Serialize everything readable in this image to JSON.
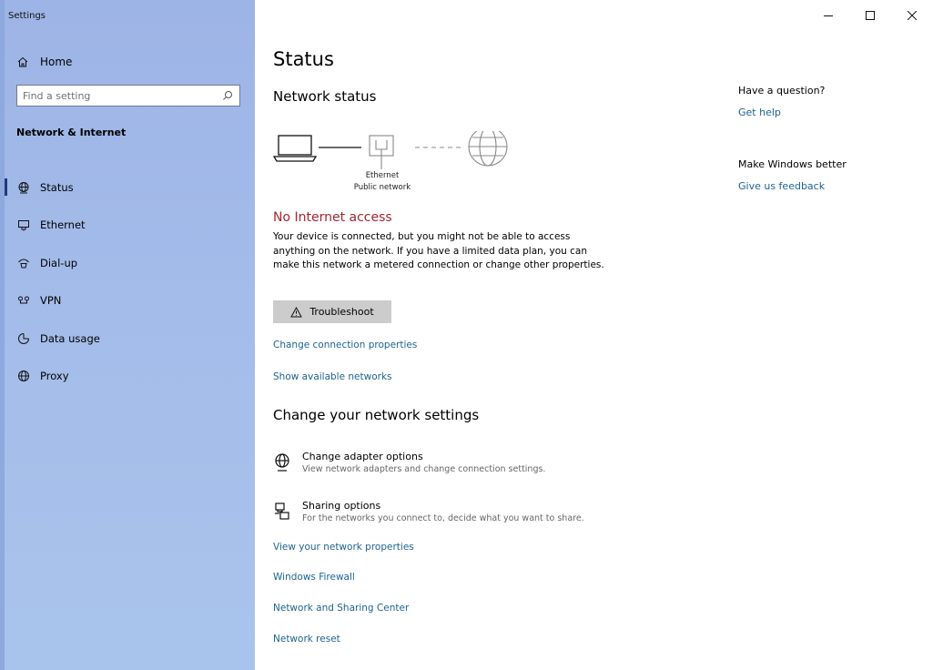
{
  "window": {
    "app_title": "Settings",
    "controls": {
      "minimize": "–",
      "maximize": "□",
      "close": "✕"
    }
  },
  "sidebar": {
    "home_label": "Home",
    "search_placeholder": "Find a setting",
    "section_title": "Network & Internet",
    "items": [
      {
        "label": "Status",
        "icon": "globe-icon",
        "active": true
      },
      {
        "label": "Ethernet",
        "icon": "ethernet-icon",
        "active": false
      },
      {
        "label": "Dial-up",
        "icon": "dialup-icon",
        "active": false
      },
      {
        "label": "VPN",
        "icon": "vpn-icon",
        "active": false
      },
      {
        "label": "Data usage",
        "icon": "data-usage-icon",
        "active": false
      },
      {
        "label": "Proxy",
        "icon": "globe-icon",
        "active": false
      }
    ]
  },
  "main": {
    "title": "Status",
    "network_status_heading": "Network status",
    "diagram": {
      "adapter_label": "Ethernet",
      "network_type": "Public network"
    },
    "alert_title": "No Internet access",
    "description": "Your device is connected, but you might not be able to access anything on the network. If you have a limited data plan, you can make this network a metered connection or change other properties.",
    "troubleshoot_label": "Troubleshoot",
    "links_top": [
      "Change connection properties",
      "Show available networks"
    ],
    "change_heading": "Change your network settings",
    "options": [
      {
        "title": "Change adapter options",
        "desc": "View network adapters and change connection settings.",
        "icon": "adapter-icon"
      },
      {
        "title": "Sharing options",
        "desc": "For the networks you connect to, decide what you want to share.",
        "icon": "sharing-icon"
      }
    ],
    "links_bottom": [
      "View your network properties",
      "Windows Firewall",
      "Network and Sharing Center",
      "Network reset"
    ]
  },
  "right": {
    "question": "Have a question?",
    "get_help": "Get help",
    "make_better": "Make Windows better",
    "feedback": "Give us feedback"
  },
  "colors": {
    "accent_link": "#1c6390",
    "alert": "#a4262c",
    "sidebar_bg": "#a3bbe9",
    "button_bg": "#cccccc"
  }
}
